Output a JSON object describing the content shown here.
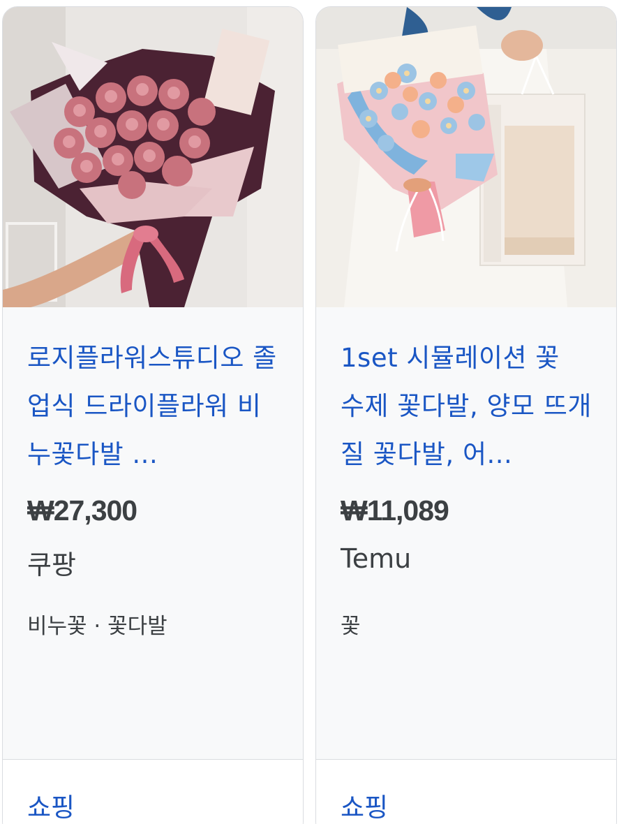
{
  "products": [
    {
      "title": "로지플라워스튜디오 졸업식 드라이플라워 비누꽃다발 ...",
      "price": "₩27,300",
      "seller": "쿠팡",
      "tags": "비누꽃 · 꽃다발",
      "category_label": "쇼핑",
      "image": "pink-rose-bouquet-image"
    },
    {
      "title": "1set 시뮬레이션 꽃 수제 꽃다발, 양모 뜨개질 꽃다발, 어...",
      "price": "₩11,089",
      "seller": "Temu",
      "tags": "꽃",
      "category_label": "쇼핑",
      "image": "knitted-flower-bouquet-image"
    }
  ],
  "colors": {
    "link": "#1a56c4",
    "text": "#3c4043",
    "card_bg": "#f8f9fa",
    "border": "#dadce0"
  }
}
